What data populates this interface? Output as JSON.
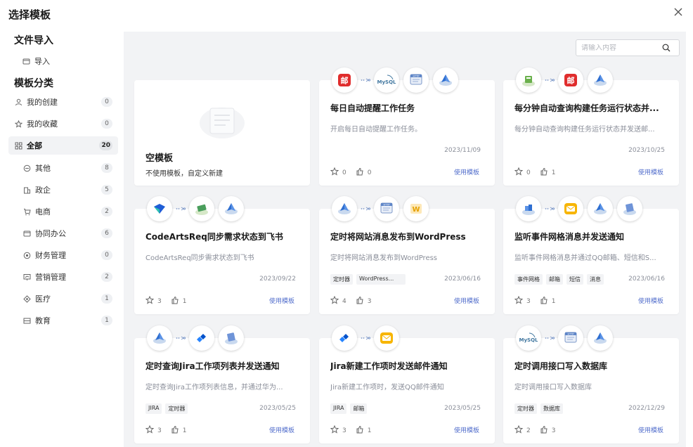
{
  "dialog": {
    "title": "选择模板"
  },
  "sidebar": {
    "import_section": "文件导入",
    "import_item": "导入",
    "category_section": "模板分类",
    "top_items": [
      {
        "label": "我的创建",
        "count": "0",
        "icon": "user-icon"
      },
      {
        "label": "我的收藏",
        "count": "0",
        "icon": "star-icon"
      },
      {
        "label": "全部",
        "count": "20",
        "icon": "grid-icon",
        "active": true
      }
    ],
    "sub_items": [
      {
        "label": "其他",
        "count": "8",
        "icon": "minus-circle-icon"
      },
      {
        "label": "政企",
        "count": "5",
        "icon": "building-icon"
      },
      {
        "label": "电商",
        "count": "2",
        "icon": "cart-icon"
      },
      {
        "label": "协同办公",
        "count": "6",
        "icon": "window-icon"
      },
      {
        "label": "财务管理",
        "count": "0",
        "icon": "coin-icon"
      },
      {
        "label": "营销管理",
        "count": "2",
        "icon": "chart-icon"
      },
      {
        "label": "医疗",
        "count": "1",
        "icon": "medical-icon"
      },
      {
        "label": "教育",
        "count": "1",
        "icon": "book-icon"
      }
    ]
  },
  "search": {
    "placeholder": "请输入内容"
  },
  "use_label": "使用模板",
  "blank_card": {
    "title": "空模板",
    "desc": "不使用模板，自定义新建"
  },
  "cards": [
    {
      "title": "每日自动提醒工作任务",
      "desc": "开启每日自动提醒工作任务。",
      "date": "2023/11/09",
      "stars": "0",
      "likes": "0",
      "tags": [],
      "icons": [
        "mail-red-icon",
        "mysql-icon",
        "http-icon",
        "cloud-icon"
      ]
    },
    {
      "title": "每分钟自动查询构建任务运行状态并...",
      "desc": "每分钟自动查询构建任务运行状态并发送邮...",
      "date": "2023/10/25",
      "stars": "0",
      "likes": "1",
      "tags": [],
      "icons": [
        "build-icon",
        "mail-red-icon",
        "cloud-icon"
      ]
    },
    {
      "title": "CodeArtsReq同步需求状态到飞书",
      "desc": "CodeArtsReq同步需求状态到飞书",
      "date": "2023/09/22",
      "stars": "3",
      "likes": "1",
      "tags": [],
      "icons": [
        "codearts-icon",
        "sync-icon",
        "cloud-icon"
      ]
    },
    {
      "title": "定时将网站消息发布到WordPress",
      "desc": "定时将网站消息发布到WordPress",
      "date": "2023/06/16",
      "stars": "4",
      "likes": "3",
      "tags": [
        "定时器",
        "WordPress..."
      ],
      "icons": [
        "cloud-icon",
        "http-icon",
        "wordpress-icon"
      ]
    },
    {
      "title": "监听事件网格消息并发送通知",
      "desc": "监听事件网格消息并通过QQ邮箱、短信和S...",
      "date": "2023/06/16",
      "stars": "3",
      "likes": "1",
      "tags": [
        "事件网格",
        "邮箱",
        "短信",
        "消息"
      ],
      "icons": [
        "grid-event-icon",
        "qqmail-icon",
        "cloud-icon",
        "message-icon"
      ]
    },
    {
      "title": "定时查询Jira工作项列表并发送通知",
      "desc": "定时查询Jira工作项列表信息，并通过华为...",
      "date": "2023/05/25",
      "stars": "3",
      "likes": "1",
      "tags": [
        "JIRA",
        "定时器"
      ],
      "icons": [
        "cloud-icon",
        "jira-icon",
        "message-icon"
      ]
    },
    {
      "title": "Jira新建工作项时发送邮件通知",
      "desc": "Jira新建工作项时，发送QQ邮件通知",
      "date": "2023/05/25",
      "stars": "3",
      "likes": "1",
      "tags": [
        "JIRA",
        "邮箱"
      ],
      "icons": [
        "jira-icon",
        "qqmail-icon"
      ]
    },
    {
      "title": "定时调用接口写入数据库",
      "desc": "定时调用接口写入数据库",
      "date": "2022/12/29",
      "stars": "2",
      "likes": "3",
      "tags": [
        "定时器",
        "数据库"
      ],
      "icons": [
        "mysql-icon",
        "http-icon",
        "cloud-icon"
      ]
    }
  ]
}
